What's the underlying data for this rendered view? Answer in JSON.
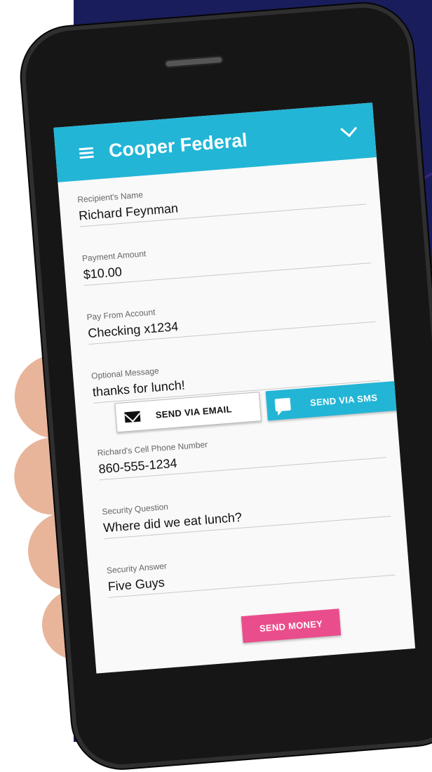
{
  "app": {
    "title": "Cooper Federal"
  },
  "form": {
    "recipient_name": {
      "label": "Recipient's Name",
      "value": "Richard Feynman"
    },
    "payment_amount": {
      "label": "Payment Amount",
      "value": "$10.00"
    },
    "pay_from_account": {
      "label": "Pay From Account",
      "value": "Checking x1234"
    },
    "optional_message": {
      "label": "Optional Message",
      "value": "thanks for lunch!"
    },
    "cell_phone": {
      "label": "Richard's Cell Phone Number",
      "value": "860-555-1234"
    },
    "security_question": {
      "label": "Security Question",
      "value": "Where did we eat lunch?"
    },
    "security_answer": {
      "label": "Security Answer",
      "value": "Five Guys"
    }
  },
  "buttons": {
    "send_email": "SEND VIA EMAIL",
    "send_sms": "SEND VIA SMS",
    "send_money": "SEND MONEY"
  },
  "icons": {
    "menu": "hamburger-menu-icon",
    "expand": "chevron-down-icon",
    "email": "envelope-icon",
    "sms": "chat-bubble-icon"
  },
  "colors": {
    "appbar": "#22b5d6",
    "sms_button": "#22b5d6",
    "send_money_button": "#ea4d8b",
    "background_panel": "#1a1d5c"
  }
}
